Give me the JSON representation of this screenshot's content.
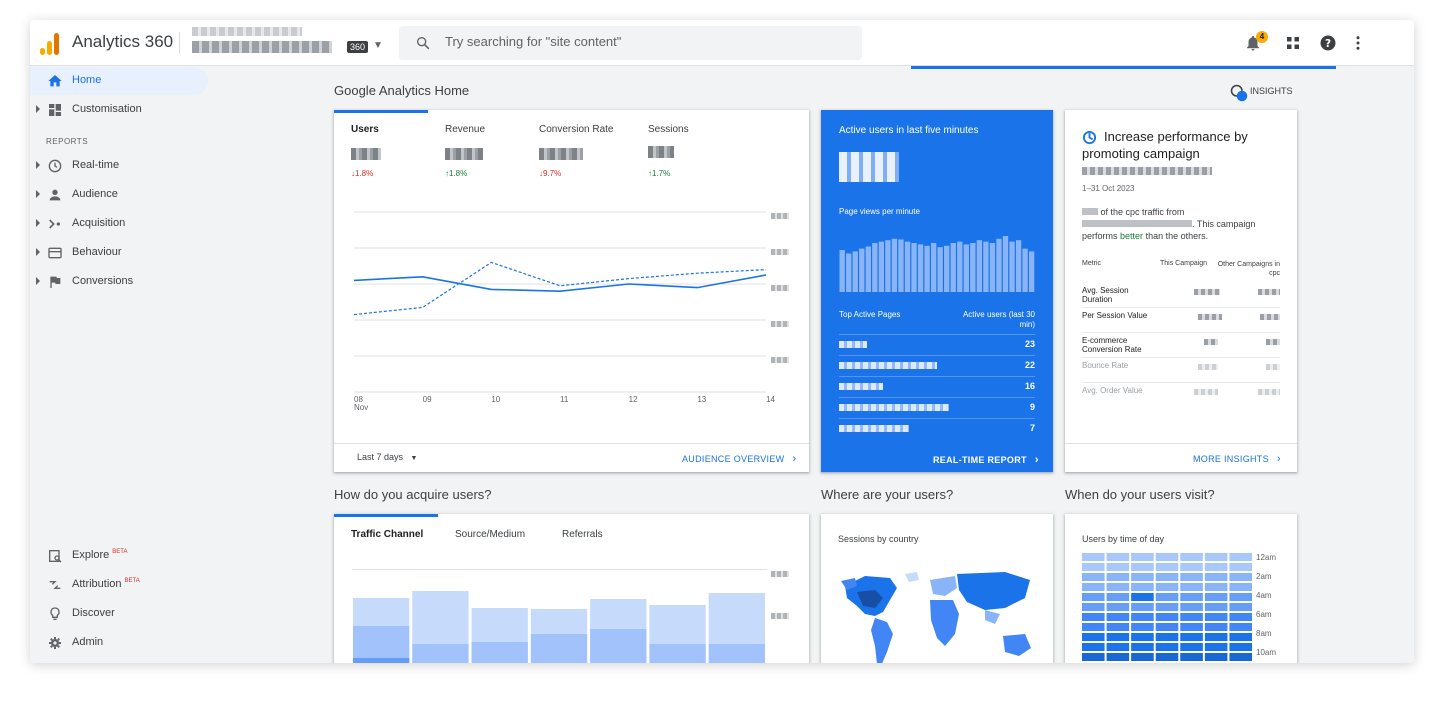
{
  "app": {
    "title": "Analytics 360",
    "badge": "360"
  },
  "search": {
    "placeholder": "Try searching for \"site content\""
  },
  "topbar": {
    "notification_count": "4"
  },
  "sidebar": {
    "items": [
      {
        "label": "Home",
        "icon": "home-icon"
      },
      {
        "label": "Customisation",
        "icon": "dashboard-icon"
      },
      {
        "label": "Real-time",
        "icon": "clock-icon"
      },
      {
        "label": "Audience",
        "icon": "person-icon"
      },
      {
        "label": "Acquisition",
        "icon": "acquisition-icon"
      },
      {
        "label": "Behaviour",
        "icon": "behaviour-icon"
      },
      {
        "label": "Conversions",
        "icon": "flag-icon"
      }
    ],
    "reports_heading": "REPORTS",
    "bottom": [
      {
        "label": "Explore",
        "beta": "BETA",
        "icon": "explore-icon"
      },
      {
        "label": "Attribution",
        "beta": "BETA",
        "icon": "attribution-icon"
      },
      {
        "label": "Discover",
        "icon": "lightbulb-icon"
      },
      {
        "label": "Admin",
        "icon": "gear-icon"
      }
    ]
  },
  "home": {
    "title": "Google Analytics Home",
    "insights_label": "INSIGHTS",
    "insights_badge": "9+"
  },
  "overview": {
    "metrics": [
      {
        "label": "Users",
        "delta": "↓1.8%",
        "direction": "down"
      },
      {
        "label": "Revenue",
        "delta": "↑1.8%",
        "direction": "up"
      },
      {
        "label": "Conversion Rate",
        "delta": "↓9.7%",
        "direction": "down"
      },
      {
        "label": "Sessions",
        "delta": "↑1.7%",
        "direction": "up"
      }
    ],
    "date_range": "Last 7 days",
    "link": "AUDIENCE OVERVIEW"
  },
  "chart_data": {
    "type": "line",
    "x": [
      "08\nNov",
      "09",
      "10",
      "11",
      "12",
      "13",
      "14"
    ],
    "series": [
      {
        "values": [
          0.62,
          0.64,
          0.57,
          0.56,
          0.6,
          0.58,
          0.65
        ],
        "style": "solid"
      },
      {
        "values": [
          0.43,
          0.47,
          0.72,
          0.59,
          0.63,
          0.66,
          0.68
        ],
        "style": "dashed"
      }
    ],
    "ylim": [
      0,
      1
    ],
    "grid": true,
    "color": "#1a73e8"
  },
  "realtime": {
    "title": "Active users in last five minutes",
    "subtitle": "Page views per minute",
    "col_pages": "Top Active Pages",
    "col_users": "Active users (last 30 min)",
    "rows": [
      {
        "value": "23"
      },
      {
        "value": "22"
      },
      {
        "value": "16"
      },
      {
        "value": "9"
      },
      {
        "value": "7"
      }
    ],
    "bars": [
      0.6,
      0.55,
      0.58,
      0.62,
      0.65,
      0.7,
      0.72,
      0.74,
      0.76,
      0.75,
      0.72,
      0.7,
      0.68,
      0.66,
      0.7,
      0.64,
      0.66,
      0.7,
      0.72,
      0.68,
      0.7,
      0.74,
      0.72,
      0.7,
      0.76,
      0.8,
      0.72,
      0.74,
      0.62,
      0.58
    ],
    "link": "REAL-TIME REPORT",
    "background": "#1a73e8"
  },
  "insight": {
    "title": "Increase performance by promoting campaign",
    "date": "1–31 Oct 2023",
    "text_a": "of the cpc traffic from",
    "text_b": ". This campaign performs",
    "text_better": "better",
    "text_c": "than the others.",
    "col_metric": "Metric",
    "col_this": "This Campaign",
    "col_other": "Other Campaigns in cpc",
    "rows": [
      {
        "label": "Avg. Session Duration"
      },
      {
        "label": "Per Session Value"
      },
      {
        "label": "E-commerce Conversion Rate"
      },
      {
        "label": "Bounce Rate"
      },
      {
        "label": "Avg. Order Value"
      }
    ],
    "link": "MORE INSIGHTS"
  },
  "acquire": {
    "title": "How do you acquire users?",
    "tabs": [
      "Traffic Channel",
      "Source/Medium",
      "Referrals"
    ],
    "bars": [
      {
        "total": 0.66,
        "mid": 0.38,
        "low": 0.06
      },
      {
        "total": 0.73,
        "mid": 0.2,
        "low": 0.0
      },
      {
        "total": 0.56,
        "mid": 0.22,
        "low": 0.0
      },
      {
        "total": 0.55,
        "mid": 0.3,
        "low": 0.0
      },
      {
        "total": 0.65,
        "mid": 0.35,
        "low": 0.0
      },
      {
        "total": 0.59,
        "mid": 0.2,
        "low": 0.0
      },
      {
        "total": 0.71,
        "mid": 0.2,
        "low": 0.0
      }
    ]
  },
  "where": {
    "title": "Where are your users?",
    "subtitle": "Sessions by country"
  },
  "when": {
    "title": "When do your users visit?",
    "subtitle": "Users by time of day",
    "hours": [
      "12am",
      "2am",
      "4am",
      "6am",
      "8am",
      "10am"
    ]
  }
}
